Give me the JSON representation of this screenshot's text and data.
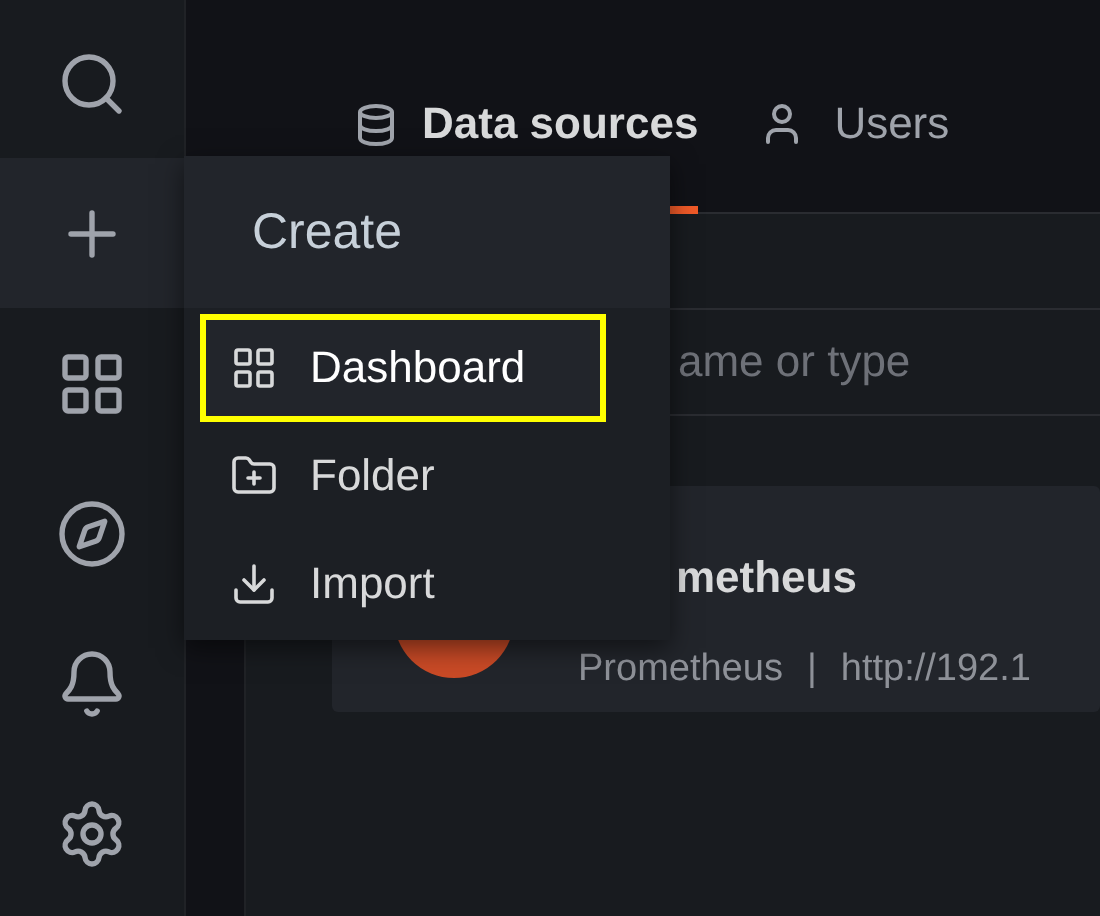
{
  "sidebar": {
    "items": [
      {
        "kind": "search",
        "selected": false
      },
      {
        "kind": "create",
        "selected": true
      },
      {
        "kind": "dashboards",
        "selected": false
      },
      {
        "kind": "explore",
        "selected": false
      },
      {
        "kind": "alerting",
        "selected": false
      },
      {
        "kind": "configuration",
        "selected": false
      }
    ]
  },
  "tabs": [
    {
      "label": "Data sources",
      "kind": "database",
      "selected": true
    },
    {
      "label": "Users",
      "kind": "user",
      "selected": false
    }
  ],
  "search": {
    "placeholder": "ame or type"
  },
  "datasource": {
    "name": "metheus",
    "type": "Prometheus",
    "separator": "|",
    "url": "http://192.1"
  },
  "menu": {
    "title": "Create",
    "items": [
      {
        "label": "Dashboard",
        "kind": "dashboard",
        "selected": true
      },
      {
        "label": "Folder",
        "kind": "folder",
        "selected": false
      },
      {
        "label": "Import",
        "kind": "import",
        "selected": false
      }
    ]
  }
}
